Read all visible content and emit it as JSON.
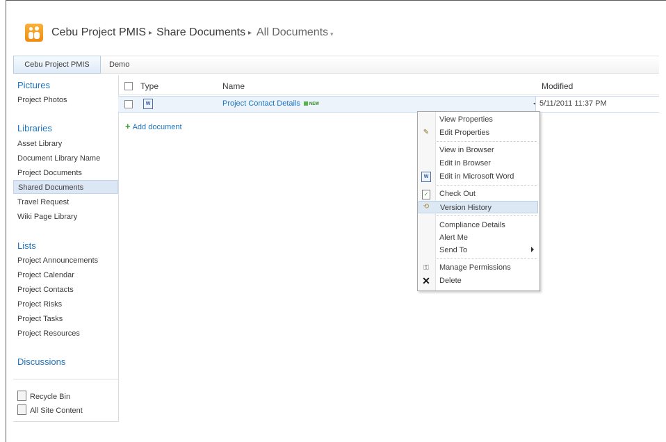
{
  "breadcrumb": {
    "site": "Cebu Project PMIS",
    "separator": "▸",
    "library": "Share Documents",
    "view": "All Documents",
    "view_dropdown_glyph": "▾"
  },
  "topnav": {
    "tabs": [
      "Cebu Project PMIS",
      "Demo"
    ]
  },
  "quicklaunch": {
    "pictures_heading": "Pictures",
    "pictures_items": [
      "Project Photos"
    ],
    "libraries_heading": "Libraries",
    "libraries_items": [
      "Asset Library",
      "Document Library Name",
      "Project Documents",
      "Shared Documents",
      "Travel Request",
      "Wiki Page Library"
    ],
    "lists_heading": "Lists",
    "lists_items": [
      "Project Announcements",
      "Project Calendar",
      "Project Contacts",
      "Project Risks",
      "Project Tasks",
      "Project Resources"
    ],
    "discussions_heading": "Discussions",
    "recycle_bin": "Recycle Bin",
    "all_site_content": "All Site Content",
    "selected_item": "Shared Documents"
  },
  "list": {
    "columns": [
      "Type",
      "Name",
      "Modified"
    ],
    "rows": [
      {
        "name": "Project Contact Details",
        "badge": "NEW",
        "modified": "5/11/2011 11:37 PM",
        "type_icon": "word-document-icon"
      }
    ],
    "add_document": "Add document"
  },
  "context_menu": {
    "items": [
      {
        "label": "View Properties"
      },
      {
        "label": "Edit Properties",
        "icon": "edit-properties-icon"
      },
      {
        "label": "View in Browser"
      },
      {
        "label": "Edit in Browser"
      },
      {
        "label": "Edit in Microsoft Word",
        "icon": "word-icon"
      },
      {
        "label": "Check Out",
        "icon": "check-out-icon"
      },
      {
        "label": "Version History",
        "icon": "version-history-icon",
        "highlighted": true
      },
      {
        "label": "Compliance Details"
      },
      {
        "label": "Alert Me"
      },
      {
        "label": "Send To",
        "has_submenu": true
      },
      {
        "label": "Manage Permissions",
        "icon": "permissions-icon"
      },
      {
        "label": "Delete",
        "icon": "delete-icon"
      }
    ]
  },
  "colors": {
    "link": "#1e73be",
    "highlight": "#dde8f5",
    "selected_row": "#ecf3fb",
    "logo_orange": "#f39c1c"
  }
}
